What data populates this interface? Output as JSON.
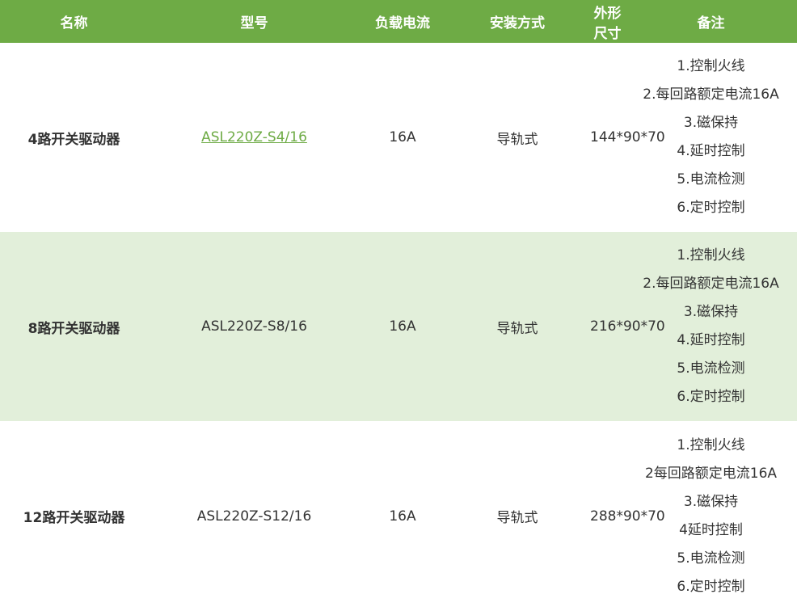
{
  "headers": {
    "name": "名称",
    "model": "型号",
    "load_current": "负载电流",
    "install": "安装方式",
    "dimensions": "外形尺寸",
    "notes": "备注"
  },
  "colors": {
    "header_bg": "#6eab45",
    "header_text": "#ffffff",
    "row_alt_bg": "#e2efda",
    "link": "#6eab45"
  },
  "rows": [
    {
      "name": "4路开关驱动器",
      "model": "ASL220Z-S4/16",
      "model_is_link": true,
      "load_current": "16A",
      "install": "导轨式",
      "dimensions": "144*90*70",
      "notes": [
        "1.控制火线",
        "2.每回路额定电流16A",
        "3.磁保持",
        "4.延时控制",
        "5.电流检测",
        "6.定时控制"
      ]
    },
    {
      "name": "8路开关驱动器",
      "model": "ASL220Z-S8/16",
      "model_is_link": false,
      "load_current": "16A",
      "install": "导轨式",
      "dimensions": "216*90*70",
      "notes": [
        "1.控制火线",
        "2.每回路额定电流16A",
        "3.磁保持",
        "4.延时控制",
        "5.电流检测",
        "6.定时控制"
      ]
    },
    {
      "name": "12路开关驱动器",
      "model": "ASL220Z-S12/16",
      "model_is_link": false,
      "load_current": "16A",
      "install": "导轨式",
      "dimensions": "288*90*70",
      "notes": [
        "1.控制火线",
        "2每回路额定电流16A",
        "3.磁保持",
        "4延时控制",
        "5.电流检测",
        "6.定时控制"
      ]
    }
  ]
}
